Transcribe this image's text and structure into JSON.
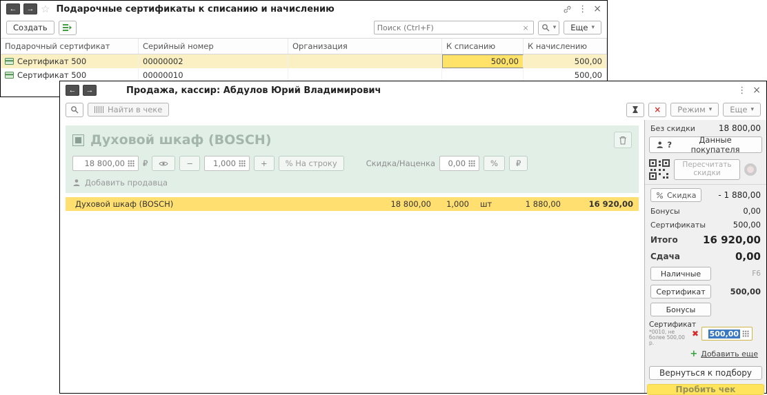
{
  "icons": {
    "back": "←",
    "forward": "→",
    "star": "☆",
    "menu": "⋮",
    "close": "×",
    "dropdown": "▾",
    "clear": "×",
    "minus": "−",
    "plus": "+",
    "percent": "%",
    "ruble": "₽",
    "remove": "✖",
    "question": "?"
  },
  "certificates_window": {
    "title": "Подарочные сертификаты к списанию и начислению",
    "create_button": "Создать",
    "search_placeholder": "Поиск (Ctrl+F)",
    "more_button": "Еще",
    "columns": [
      "Подарочный сертификат",
      "Серийный номер",
      "Организация",
      "К списанию",
      "К начислению"
    ],
    "rows": [
      {
        "certificate": "Сертификат 500",
        "serial": "00000002",
        "organization": "",
        "writeoff": "500,00",
        "accrual": "500,00"
      },
      {
        "certificate": "Сертификат 500",
        "serial": "00000010",
        "organization": "",
        "writeoff": "",
        "accrual": "500,00"
      }
    ]
  },
  "sale_window": {
    "title": "Продажа, кассир: Абдулов Юрий Владимирович",
    "find_button": "Найти в чеке",
    "mode_button": "Режим",
    "more_button": "Еще",
    "product_editor": {
      "name": "Духовой шкаф (BOSCH)",
      "price": "18 800,00",
      "quantity": "1,000",
      "per_line_button": "% На строку",
      "discount_label": "Скидка/Наценка",
      "discount_value": "0,00",
      "add_seller": "Добавить продавца"
    },
    "receipt_rows": [
      {
        "name": "Духовой шкаф (BOSCH)",
        "price": "18 800,00",
        "qty": "1,000",
        "unit": "шт",
        "discount": "1 880,00",
        "total": "16 920,00"
      }
    ],
    "totals": {
      "no_discount_label": "Без скидки",
      "no_discount_value": "18 800,00",
      "customer_button": "Данные покупателя",
      "recalc_button": "Пересчитать скидки",
      "discount_button": "Скидка",
      "discount_value": "- 1 880,00",
      "bonuses_label": "Бонусы",
      "bonuses_value": "0,00",
      "certificates_label": "Сертификаты",
      "certificates_value": "500,00",
      "total_label": "Итого",
      "total_value": "16 920,00",
      "change_label": "Сдача",
      "change_value": "0,00"
    },
    "payments": {
      "cash_button": "Наличные",
      "cash_hotkey": "F6",
      "certificate_button": "Сертификат",
      "certificate_value": "500,00",
      "bonuses_button": "Бонусы",
      "cert_line_label": "Сертификат",
      "cert_line_note": "*0010, не более 500,00 р.",
      "cert_line_amount": "500,00",
      "add_more": "Добавить еще"
    },
    "footer": {
      "back_button": "Вернуться к подбору",
      "checkout_button": "Пробить чек"
    }
  }
}
